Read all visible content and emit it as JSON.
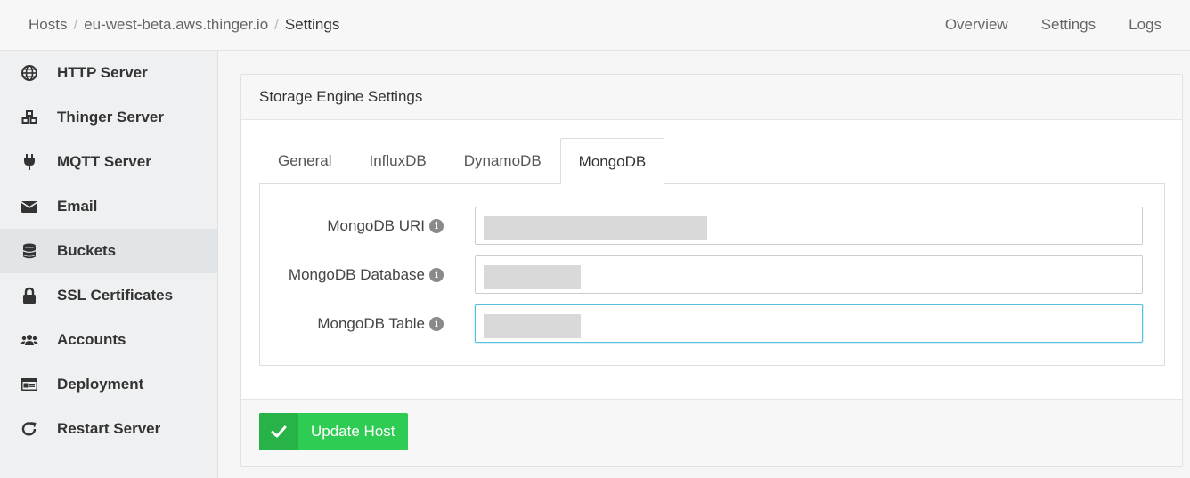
{
  "breadcrumb": {
    "items": [
      "Hosts",
      "eu-west-beta.aws.thinger.io",
      "Settings"
    ],
    "separator": "/"
  },
  "topnav": {
    "overview": "Overview",
    "settings": "Settings",
    "logs": "Logs"
  },
  "sidebar": {
    "items": [
      {
        "label": "HTTP Server",
        "icon": "globe-icon"
      },
      {
        "label": "Thinger Server",
        "icon": "cubes-icon"
      },
      {
        "label": "MQTT Server",
        "icon": "plug-icon"
      },
      {
        "label": "Email",
        "icon": "envelope-icon"
      },
      {
        "label": "Buckets",
        "icon": "database-icon"
      },
      {
        "label": "SSL Certificates",
        "icon": "lock-icon"
      },
      {
        "label": "Accounts",
        "icon": "users-icon"
      },
      {
        "label": "Deployment",
        "icon": "id-card-icon"
      },
      {
        "label": "Restart Server",
        "icon": "redo-icon"
      }
    ],
    "active_index": 4
  },
  "panel": {
    "title": "Storage Engine Settings",
    "tabs": [
      "General",
      "InfluxDB",
      "DynamoDB",
      "MongoDB"
    ],
    "active_tab": "MongoDB",
    "fields": [
      {
        "label": "MongoDB URI",
        "value": "",
        "info": "i"
      },
      {
        "label": "MongoDB Database",
        "value": "",
        "info": "i"
      },
      {
        "label": "MongoDB Table",
        "value": "",
        "info": "i"
      }
    ],
    "submit_label": "Update Host"
  },
  "colors": {
    "accent_green": "#2ecc52",
    "focus_border": "#5bc0de"
  }
}
